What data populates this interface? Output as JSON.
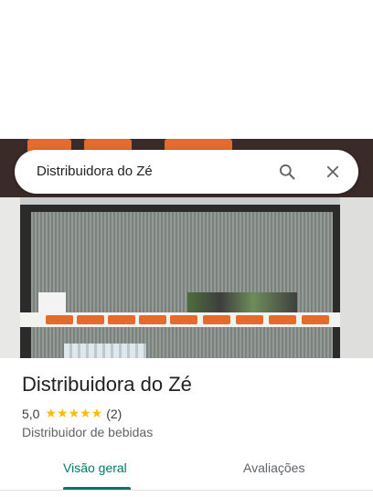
{
  "search": {
    "value": "Distribuidora do Zé"
  },
  "place": {
    "name": "Distribuidora do Zé",
    "rating": "5,0",
    "stars": "★★★★★",
    "review_count": "(2)",
    "category": "Distribuidor de bebidas"
  },
  "tabs": [
    {
      "label": "Visão geral",
      "active": true
    },
    {
      "label": "Avaliações",
      "active": false
    }
  ],
  "colors": {
    "accent": "#00796b",
    "star": "#fbbc04"
  }
}
